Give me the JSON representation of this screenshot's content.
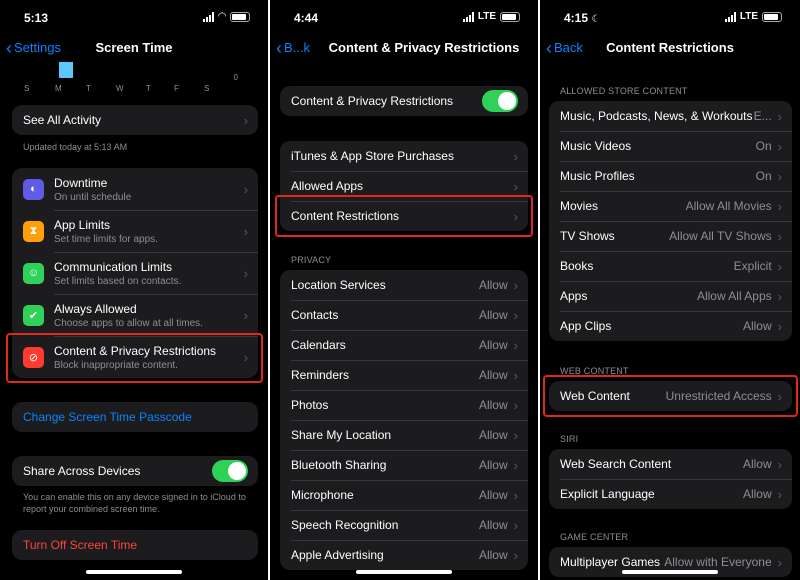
{
  "phone1": {
    "time": "5:13",
    "nav": {
      "back": "Settings",
      "title": "Screen Time"
    },
    "chart": {
      "days": [
        "S",
        "M",
        "T",
        "W",
        "T",
        "F",
        "S"
      ],
      "zero": "0"
    },
    "see_all": "See All Activity",
    "updated": "Updated today at 5:13 AM",
    "items": [
      {
        "label": "Downtime",
        "sub": "On until schedule",
        "icon": "downtime-icon",
        "color": "#5e5ce6"
      },
      {
        "label": "App Limits",
        "sub": "Set time limits for apps.",
        "icon": "hourglass-icon",
        "color": "#ff9f0a"
      },
      {
        "label": "Communication Limits",
        "sub": "Set limits based on contacts.",
        "icon": "contact-icon",
        "color": "#30d158"
      },
      {
        "label": "Always Allowed",
        "sub": "Choose apps to allow at all times.",
        "icon": "checkmark-icon",
        "color": "#30d158"
      },
      {
        "label": "Content & Privacy Restrictions",
        "sub": "Block inappropriate content.",
        "icon": "restriction-icon",
        "color": "#ff3b30"
      }
    ],
    "passcode": "Change Screen Time Passcode",
    "share": "Share Across Devices",
    "share_note": "You can enable this on any device signed in to iCloud to report your combined screen time.",
    "turn_off": "Turn Off Screen Time"
  },
  "phone2": {
    "time": "4:44",
    "network": "LTE",
    "nav": {
      "back": "B...k",
      "title": "Content & Privacy Restrictions"
    },
    "toggle_label": "Content & Privacy Restrictions",
    "store_items": [
      "iTunes & App Store Purchases",
      "Allowed Apps",
      "Content Restrictions"
    ],
    "privacy_header": "PRIVACY",
    "privacy_items": [
      {
        "label": "Location Services",
        "value": "Allow"
      },
      {
        "label": "Contacts",
        "value": "Allow"
      },
      {
        "label": "Calendars",
        "value": "Allow"
      },
      {
        "label": "Reminders",
        "value": "Allow"
      },
      {
        "label": "Photos",
        "value": "Allow"
      },
      {
        "label": "Share My Location",
        "value": "Allow"
      },
      {
        "label": "Bluetooth Sharing",
        "value": "Allow"
      },
      {
        "label": "Microphone",
        "value": "Allow"
      },
      {
        "label": "Speech Recognition",
        "value": "Allow"
      },
      {
        "label": "Apple Advertising",
        "value": "Allow"
      }
    ]
  },
  "phone3": {
    "time": "4:15",
    "network": "LTE",
    "nav": {
      "back": "Back",
      "title": "Content Restrictions"
    },
    "store_header": "ALLOWED STORE CONTENT",
    "store_items": [
      {
        "label": "Music, Podcasts, News, & Workouts",
        "value": "E..."
      },
      {
        "label": "Music Videos",
        "value": "On"
      },
      {
        "label": "Music Profiles",
        "value": "On"
      },
      {
        "label": "Movies",
        "value": "Allow All Movies"
      },
      {
        "label": "TV Shows",
        "value": "Allow All TV Shows"
      },
      {
        "label": "Books",
        "value": "Explicit"
      },
      {
        "label": "Apps",
        "value": "Allow All Apps"
      },
      {
        "label": "App Clips",
        "value": "Allow"
      }
    ],
    "web_header": "WEB CONTENT",
    "web": {
      "label": "Web Content",
      "value": "Unrestricted Access"
    },
    "siri_header": "SIRI",
    "siri_items": [
      {
        "label": "Web Search Content",
        "value": "Allow"
      },
      {
        "label": "Explicit Language",
        "value": "Allow"
      }
    ],
    "game_header": "GAME CENTER",
    "game_items": [
      {
        "label": "Multiplayer Games",
        "value": "Allow with Everyone"
      }
    ]
  },
  "colors": {
    "accent": "#0a84ff",
    "highlight": "#e0281b",
    "toggle_on": "#30d158",
    "destructive": "#ff453a"
  }
}
